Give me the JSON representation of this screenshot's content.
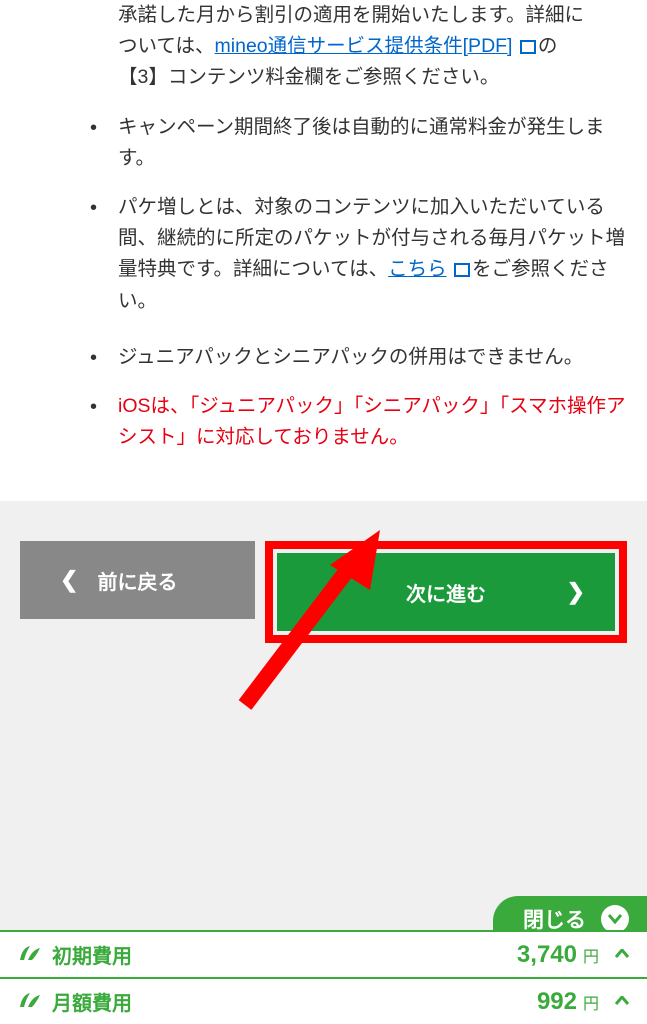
{
  "notes": {
    "partial_top_line1": "承諾した月から割引の適用を開始いたします。詳細については、",
    "pdf_link": "mineo通信サービス提供条件[PDF]",
    "partial_top_line2": "の【3】コンテンツ料金欄をご参照ください。",
    "item1": "キャンペーン期間終了後は自動的に通常料金が発生します。",
    "item2_part1": "パケ増しとは、対象のコンテンツに加入いただいている間、継続的に所定のパケットが付与される毎月パケット増量特典です。詳細については、",
    "item2_link": "こちら",
    "item2_part2": "をご参照ください。",
    "item3": "ジュニアパックとシニアパックの併用はできません。",
    "item4": "iOSは、「ジュニアパック」「シニアパック」「スマホ操作アシスト」に対応しておりません。"
  },
  "buttons": {
    "back_label": "前に戻る",
    "next_label": "次に進む"
  },
  "footer": {
    "close_label": "閉じる",
    "initial_fee_label": "初期費用",
    "initial_fee_amount": "3,740",
    "monthly_fee_label": "月額費用",
    "monthly_fee_amount": "992",
    "currency": "円"
  },
  "colors": {
    "green": "#3baa3d",
    "button_green": "#1a9a3a",
    "red": "#e60012",
    "highlight_red": "#ff0000",
    "gray_button": "#888888",
    "link_blue": "#0066cc"
  }
}
